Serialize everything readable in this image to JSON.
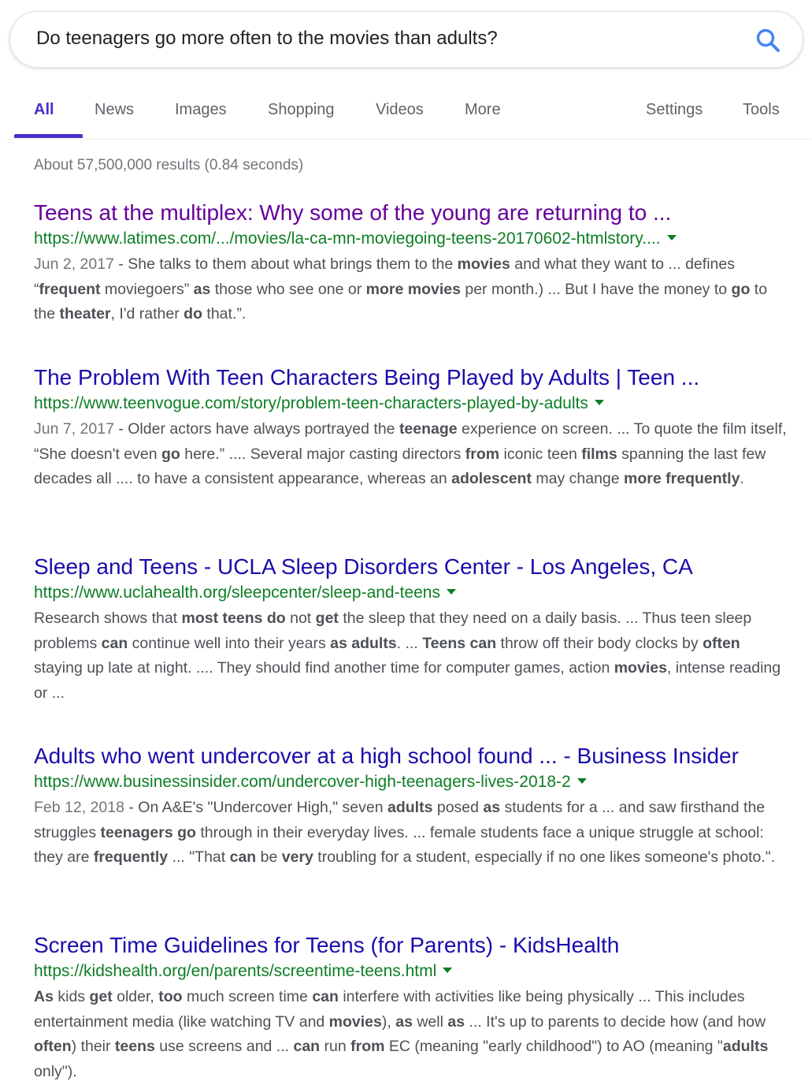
{
  "search": {
    "query": "Do teenagers go more often to the movies than adults?",
    "icon": "magnifier-icon",
    "accent": "#4285f4"
  },
  "tabs": {
    "all": "All",
    "news": "News",
    "images": "Images",
    "shopping": "Shopping",
    "videos": "Videos",
    "more": "More",
    "settings": "Settings",
    "tools": "Tools",
    "active_color": "#4a2fc7"
  },
  "stats": "About 57,500,000 results (0.84 seconds)",
  "colors": {
    "link": "#1a0dab",
    "visited_link": "#660099",
    "url": "#0d7e24",
    "snippet": "#4d5156"
  },
  "results": [
    {
      "title": "Teens at the multiplex: Why some of the young are returning to ...",
      "visited": true,
      "url": "https://www.latimes.com/.../movies/la-ca-mn-moviegoing-teens-20170602-htmlstory....",
      "date": "Jun 2, 2017",
      "snippet": [
        {
          "t": "She talks to them about what brings them to the "
        },
        {
          "t": "movies",
          "b": true
        },
        {
          "t": " and what they want to ... defines “"
        },
        {
          "t": "frequent",
          "b": true
        },
        {
          "t": " moviegoers” "
        },
        {
          "t": "as",
          "b": true
        },
        {
          "t": " those who see one or "
        },
        {
          "t": "more movies",
          "b": true
        },
        {
          "t": " per month.) ... But I have the money to "
        },
        {
          "t": "go",
          "b": true
        },
        {
          "t": " to the "
        },
        {
          "t": "theater",
          "b": true
        },
        {
          "t": ", I'd rather "
        },
        {
          "t": "do",
          "b": true
        },
        {
          "t": " that.”."
        }
      ]
    },
    {
      "title": "The Problem With Teen Characters Being Played by Adults | Teen ...",
      "visited": false,
      "url": "https://www.teenvogue.com/story/problem-teen-characters-played-by-adults",
      "date": "Jun 7, 2017",
      "snippet": [
        {
          "t": "Older actors have always portrayed the "
        },
        {
          "t": "teenage",
          "b": true
        },
        {
          "t": " experience on screen. ... To quote the film itself, “She doesn't even "
        },
        {
          "t": "go",
          "b": true
        },
        {
          "t": " here.” .... Several major casting directors "
        },
        {
          "t": "from",
          "b": true
        },
        {
          "t": " iconic teen "
        },
        {
          "t": "films",
          "b": true
        },
        {
          "t": " spanning the last few decades all .... to have a consistent appearance, whereas an "
        },
        {
          "t": "adolescent",
          "b": true
        },
        {
          "t": " may change "
        },
        {
          "t": "more frequently",
          "b": true
        },
        {
          "t": "."
        }
      ]
    },
    {
      "title": "Sleep and Teens - UCLA Sleep Disorders Center - Los Angeles, CA",
      "visited": false,
      "url": "https://www.uclahealth.org/sleepcenter/sleep-and-teens",
      "date": "",
      "snippet": [
        {
          "t": "Research shows that "
        },
        {
          "t": "most teens do",
          "b": true
        },
        {
          "t": " not "
        },
        {
          "t": "get",
          "b": true
        },
        {
          "t": " the sleep that they need on a daily basis. ... Thus teen sleep problems "
        },
        {
          "t": "can",
          "b": true
        },
        {
          "t": " continue well into their years "
        },
        {
          "t": "as adults",
          "b": true
        },
        {
          "t": ". ... "
        },
        {
          "t": "Teens can",
          "b": true
        },
        {
          "t": " throw off their body clocks by "
        },
        {
          "t": "often",
          "b": true
        },
        {
          "t": " staying up late at night. .... They should find another time for computer games, action "
        },
        {
          "t": "movies",
          "b": true
        },
        {
          "t": ", intense reading or ..."
        }
      ]
    },
    {
      "title": "Adults who went undercover at a high school found ... - Business Insider",
      "visited": false,
      "url": "https://www.businessinsider.com/undercover-high-teenagers-lives-2018-2",
      "date": "Feb 12, 2018",
      "snippet": [
        {
          "t": "On A&E's \"Undercover High,\" seven "
        },
        {
          "t": "adults",
          "b": true
        },
        {
          "t": " posed "
        },
        {
          "t": "as",
          "b": true
        },
        {
          "t": " students for a ... and saw firsthand the struggles "
        },
        {
          "t": "teenagers go",
          "b": true
        },
        {
          "t": " through in their everyday lives. ... female students face a unique struggle at school: they are "
        },
        {
          "t": "frequently",
          "b": true
        },
        {
          "t": " ... \"That "
        },
        {
          "t": "can",
          "b": true
        },
        {
          "t": " be "
        },
        {
          "t": "very",
          "b": true
        },
        {
          "t": " troubling for a student, especially if no one likes someone's photo.\"."
        }
      ]
    },
    {
      "title": "Screen Time Guidelines for Teens (for Parents) - KidsHealth",
      "visited": false,
      "url": "https://kidshealth.org/en/parents/screentime-teens.html",
      "date": "",
      "snippet": [
        {
          "t": "As",
          "b": true
        },
        {
          "t": " kids "
        },
        {
          "t": "get",
          "b": true
        },
        {
          "t": " older, "
        },
        {
          "t": "too",
          "b": true
        },
        {
          "t": " much screen time "
        },
        {
          "t": "can",
          "b": true
        },
        {
          "t": " interfere with activities like being physically ... This includes entertainment media (like watching TV and "
        },
        {
          "t": "movies",
          "b": true
        },
        {
          "t": "), "
        },
        {
          "t": "as",
          "b": true
        },
        {
          "t": " well "
        },
        {
          "t": "as",
          "b": true
        },
        {
          "t": " ... It's up to parents to decide how (and how "
        },
        {
          "t": "often",
          "b": true
        },
        {
          "t": ") their "
        },
        {
          "t": "teens",
          "b": true
        },
        {
          "t": " use screens and ... "
        },
        {
          "t": "can",
          "b": true
        },
        {
          "t": " run "
        },
        {
          "t": "from",
          "b": true
        },
        {
          "t": " EC (meaning \"early childhood\") to AO (meaning \""
        },
        {
          "t": "adults",
          "b": true
        },
        {
          "t": " only\")."
        }
      ]
    }
  ]
}
